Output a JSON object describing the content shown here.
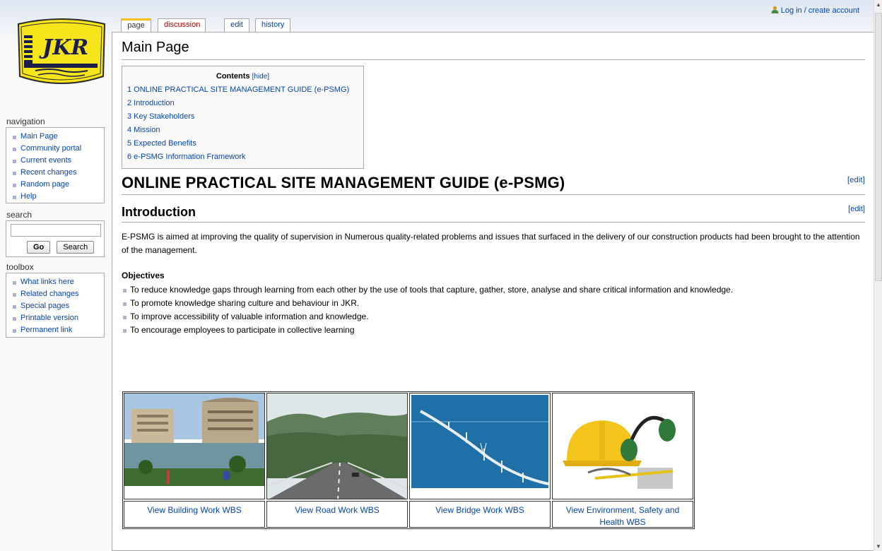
{
  "personal": {
    "login_label": "Log in / create account"
  },
  "tabs": [
    {
      "label": "page"
    },
    {
      "label": "discussion"
    },
    {
      "label": "edit"
    },
    {
      "label": "history"
    }
  ],
  "logo": {
    "text": "JKR"
  },
  "navigation": {
    "title": "navigation",
    "items": [
      "Main Page",
      "Community portal",
      "Current events",
      "Recent changes",
      "Random page",
      "Help"
    ]
  },
  "search": {
    "title": "search",
    "go_label": "Go",
    "search_label": "Search",
    "value": ""
  },
  "toolbox": {
    "title": "toolbox",
    "items": [
      "What links here",
      "Related changes",
      "Special pages",
      "Printable version",
      "Permanent link"
    ]
  },
  "page": {
    "title": "Main Page",
    "toc": {
      "title": "Contents",
      "hide_label": "[hide]",
      "items": [
        "1 ONLINE PRACTICAL SITE MANAGEMENT GUIDE (e-PSMG)",
        "2 Introduction",
        "3 Key Stakeholders",
        "4 Mission",
        "5 Expected Benefits",
        "6 e-PSMG Information Framework"
      ]
    },
    "heading1": "ONLINE PRACTICAL SITE MANAGEMENT GUIDE (e-PSMG)",
    "heading2": "Introduction",
    "edit_label": "[edit]",
    "intro_text": "E-PSMG is aimed at improving the quality of supervision in Numerous quality-related problems and issues that surfaced in the delivery of our construction products had been brought to the attention of the management.",
    "objectives_title": "Objectives",
    "objectives": [
      "To reduce knowledge gaps through learning from each other by the use of tools that capture, gather, store, analyse and share critical information and knowledge.",
      "To promote knowledge sharing culture and behaviour in JKR.",
      "To improve accessibility of valuable information and knowledge.",
      "To encourage employees to participate in collective learning"
    ],
    "wbs_links": [
      "View Building Work WBS",
      "View Road Work WBS",
      "View Bridge Work WBS",
      "View Environment, Safety and Health WBS"
    ]
  }
}
